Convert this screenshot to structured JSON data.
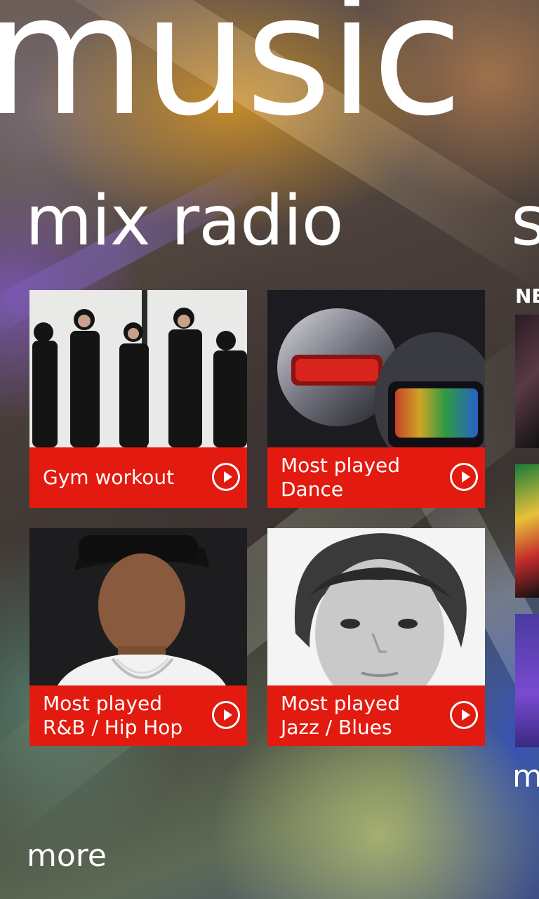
{
  "app": {
    "title": "music"
  },
  "mix_radio": {
    "title": "mix radio",
    "tiles": [
      {
        "label": "Gym workout",
        "play_icon": "play-circle-icon"
      },
      {
        "label": "Most played\nDance",
        "play_icon": "play-circle-icon"
      },
      {
        "label": "Most played\nR&B / Hip Hop",
        "play_icon": "play-circle-icon"
      },
      {
        "label": "Most played\nJazz / Blues",
        "play_icon": "play-circle-icon"
      }
    ],
    "more_label": "more"
  },
  "next_section": {
    "title_peek": "s",
    "header_peek": "NE",
    "more_peek": "m"
  },
  "colors": {
    "tile_bar": "#e31a0f",
    "text": "#ffffff"
  }
}
